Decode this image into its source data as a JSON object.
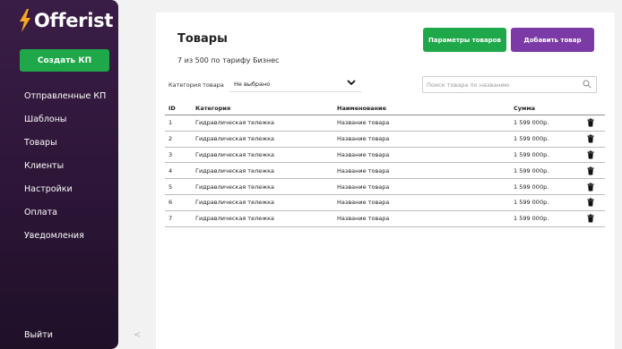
{
  "brand": {
    "name": "Offerist",
    "accent": "#f7a823"
  },
  "sidebar": {
    "create_label": "Создать КП",
    "items": [
      {
        "label": "Отправленные КП"
      },
      {
        "label": "Шаблоны"
      },
      {
        "label": "Товары"
      },
      {
        "label": "Клиенты"
      },
      {
        "label": "Настройки"
      },
      {
        "label": "Оплата"
      },
      {
        "label": "Уведомления"
      }
    ],
    "logout_label": "Выйти",
    "collapse_glyph": "<"
  },
  "main": {
    "title": "Товары",
    "plan_text": "7 из 500 по тарифу Бизнес",
    "params_button": "Параметры товаров",
    "add_button": "Добавить товар",
    "filter": {
      "label": "Категория товара",
      "value": "Не выбрано"
    },
    "search": {
      "placeholder": "Поиск товара по названию",
      "value": ""
    }
  },
  "table": {
    "columns": {
      "id": "ID",
      "category": "Категория",
      "name": "Наименование",
      "sum": "Сумма"
    },
    "rows": [
      {
        "id": "1",
        "category": "Гидравлическая тележка",
        "name": "Название товара",
        "sum": "1 599 000р."
      },
      {
        "id": "2",
        "category": "Гидравлическая тележка",
        "name": "Название товара",
        "sum": "1 599 000р."
      },
      {
        "id": "3",
        "category": "Гидравлическая тележка",
        "name": "Название товара",
        "sum": "1 599 000р."
      },
      {
        "id": "4",
        "category": "Гидравлическая тележка",
        "name": "Название товара",
        "sum": "1 599 000р."
      },
      {
        "id": "5",
        "category": "Гидравлическая тележка",
        "name": "Название товара",
        "sum": "1 599 000р."
      },
      {
        "id": "6",
        "category": "Гидравлическая тележка",
        "name": "Название товара",
        "sum": "1 599 000р."
      },
      {
        "id": "7",
        "category": "Гидравлическая тележка",
        "name": "Название товара",
        "sum": "1 599 000р."
      }
    ],
    "row_action_icon": "trash-icon"
  },
  "colors": {
    "sidebar": "#2f1739",
    "primary_green": "#1fa84a",
    "primary_purple": "#7b3aa6"
  }
}
